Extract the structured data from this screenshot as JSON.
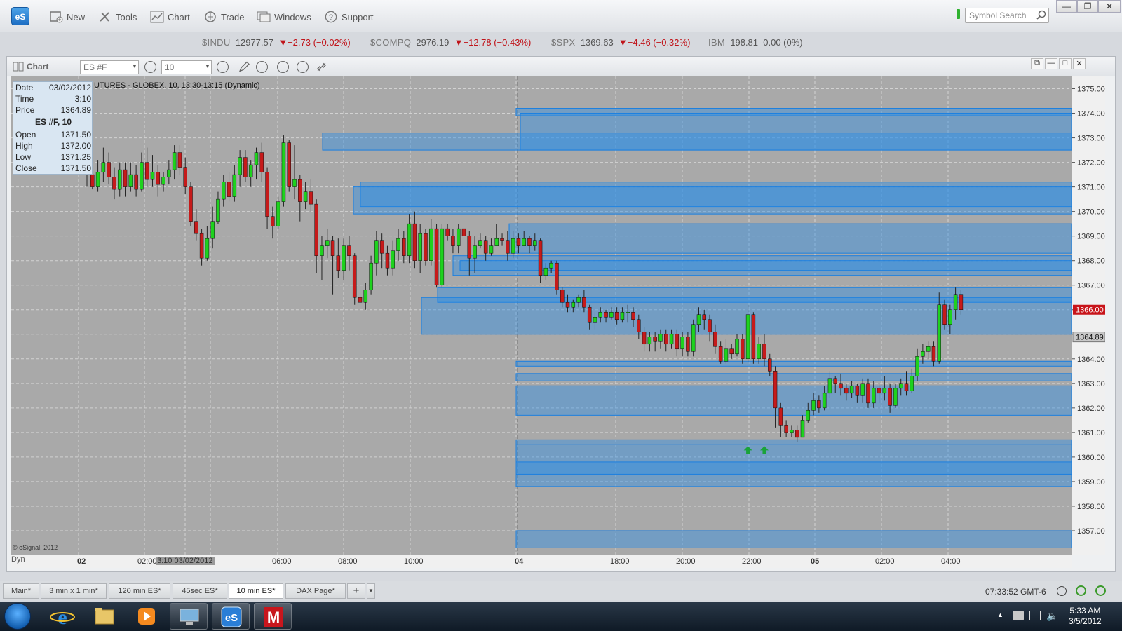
{
  "toolbar": {
    "logo": "eS",
    "items": [
      {
        "label": "New",
        "icon": "new-document-icon"
      },
      {
        "label": "Tools",
        "icon": "tools-icon"
      },
      {
        "label": "Chart",
        "icon": "chart-icon"
      },
      {
        "label": "Trade",
        "icon": "trade-icon"
      },
      {
        "label": "Windows",
        "icon": "windows-icon"
      },
      {
        "label": "Support",
        "icon": "help-icon"
      }
    ],
    "search_placeholder": "Symbol Search"
  },
  "ticker": [
    {
      "symbol": "$INDU",
      "price": "12977.57",
      "change": "▼−2.73 (−0.02%)"
    },
    {
      "symbol": "$COMPQ",
      "price": "2976.19",
      "change": "▼−12.78 (−0.43%)"
    },
    {
      "symbol": "$SPX",
      "price": "1369.63",
      "change": "▼−4.46 (−0.32%)"
    },
    {
      "symbol": "IBM",
      "price": "198.81",
      "change": "0.00 (0%)"
    }
  ],
  "chart_window": {
    "label": "Chart",
    "symbol_field": "ES #F",
    "interval_field": "10",
    "title": "UTURES - GLOBEX, 10, 13:30-13:15 (Dynamic)",
    "copyright": "© eSignal, 2012",
    "dyn": "Dyn"
  },
  "info_panel": {
    "rows_top": [
      {
        "k": "Date",
        "v": "03/02/2012"
      },
      {
        "k": "Time",
        "v": "3:10"
      },
      {
        "k": "Price",
        "v": "1364.89"
      }
    ],
    "header": "ES #F, 10",
    "rows_bottom": [
      {
        "k": "Open",
        "v": "1371.50"
      },
      {
        "k": "High",
        "v": "1372.00"
      },
      {
        "k": "Low",
        "v": "1371.25"
      },
      {
        "k": "Close",
        "v": "1371.50"
      }
    ]
  },
  "chart_data": {
    "type": "candlestick",
    "y_axis": {
      "min": 1356.0,
      "max": 1375.5,
      "ticks": [
        "1375.00",
        "1374.00",
        "1373.00",
        "1372.00",
        "1371.00",
        "1370.00",
        "1369.00",
        "1368.00",
        "1367.00",
        "1366.00",
        "1365.00",
        "1364.00",
        "1363.00",
        "1362.00",
        "1361.00",
        "1360.00",
        "1359.00",
        "1358.00",
        "1357.00"
      ]
    },
    "x_labels": [
      "02",
      "02:00",
      "3:10 03/02/2012",
      "06:00",
      "08:00",
      "10:00",
      "04",
      "18:00",
      "20:00",
      "22:00",
      "05",
      "02:00",
      "04:00"
    ],
    "last_price": "1366.00",
    "cursor_price": "1364.89",
    "zones": [
      {
        "from": 1374.2,
        "to": 1373.9
      },
      {
        "from": 1374.0,
        "to": 1372.5
      },
      {
        "from": 1373.2,
        "to": 1372.5
      },
      {
        "from": 1371.2,
        "to": 1370.2
      },
      {
        "from": 1371.0,
        "to": 1369.9
      },
      {
        "from": 1369.5,
        "to": 1368.3
      },
      {
        "from": 1368.2,
        "to": 1367.4
      },
      {
        "from": 1368.0,
        "to": 1367.6
      },
      {
        "from": 1366.9,
        "to": 1366.3
      },
      {
        "from": 1366.5,
        "to": 1365.0
      },
      {
        "from": 1363.9,
        "to": 1363.7
      },
      {
        "from": 1363.4,
        "to": 1363.1
      },
      {
        "from": 1362.9,
        "to": 1361.7
      },
      {
        "from": 1360.7,
        "to": 1360.5
      },
      {
        "from": 1360.5,
        "to": 1358.8
      },
      {
        "from": 1359.8,
        "to": 1359.3
      },
      {
        "from": 1357.0,
        "to": 1356.3
      }
    ],
    "candles": [
      [
        1371.9,
        1371.5,
        1372.8,
        1371.0
      ],
      [
        1371.5,
        1371.0,
        1372.2,
        1370.9
      ],
      [
        1371.0,
        1371.6,
        1372.1,
        1370.8
      ],
      [
        1371.6,
        1372.0,
        1372.6,
        1371.2
      ],
      [
        1372.0,
        1371.4,
        1372.4,
        1371.1
      ],
      [
        1371.4,
        1370.9,
        1371.8,
        1370.5
      ],
      [
        1370.9,
        1371.7,
        1372.0,
        1370.6
      ],
      [
        1371.7,
        1371.0,
        1372.0,
        1370.6
      ],
      [
        1371.0,
        1371.5,
        1372.0,
        1370.8
      ],
      [
        1371.5,
        1370.9,
        1371.9,
        1370.6
      ],
      [
        1370.9,
        1372.0,
        1372.4,
        1370.8
      ],
      [
        1372.0,
        1371.3,
        1372.6,
        1371.0
      ],
      [
        1371.3,
        1371.6,
        1372.3,
        1371.0
      ],
      [
        1371.6,
        1371.1,
        1371.9,
        1370.6
      ],
      [
        1371.1,
        1371.4,
        1371.6,
        1370.8
      ],
      [
        1371.4,
        1371.7,
        1372.1,
        1371.1
      ],
      [
        1371.7,
        1372.4,
        1372.7,
        1371.3
      ],
      [
        1372.4,
        1371.8,
        1372.7,
        1371.5
      ],
      [
        1371.8,
        1371.0,
        1372.2,
        1370.7
      ],
      [
        1371.0,
        1369.6,
        1371.2,
        1369.4
      ],
      [
        1369.6,
        1369.1,
        1370.1,
        1368.8
      ],
      [
        1369.1,
        1368.1,
        1369.3,
        1367.8
      ],
      [
        1368.1,
        1368.9,
        1369.4,
        1368.0
      ],
      [
        1368.9,
        1369.6,
        1370.2,
        1368.5
      ],
      [
        1369.6,
        1370.5,
        1370.8,
        1369.5
      ],
      [
        1370.5,
        1371.2,
        1371.5,
        1370.2
      ],
      [
        1371.2,
        1370.6,
        1371.6,
        1370.4
      ],
      [
        1370.6,
        1371.5,
        1371.9,
        1370.4
      ],
      [
        1371.5,
        1372.2,
        1372.5,
        1371.0
      ],
      [
        1372.2,
        1371.4,
        1372.5,
        1371.2
      ],
      [
        1371.4,
        1371.9,
        1372.1,
        1371.0
      ],
      [
        1371.9,
        1372.4,
        1372.6,
        1371.3
      ],
      [
        1372.4,
        1371.6,
        1372.8,
        1371.2
      ],
      [
        1371.6,
        1369.8,
        1371.8,
        1369.3
      ],
      [
        1369.8,
        1369.4,
        1370.2,
        1368.9
      ],
      [
        1369.4,
        1370.4,
        1370.6,
        1369.3
      ],
      [
        1370.4,
        1372.8,
        1373.1,
        1370.2
      ],
      [
        1372.8,
        1371.0,
        1372.9,
        1370.8
      ],
      [
        1371.0,
        1371.3,
        1372.7,
        1370.5
      ],
      [
        1371.3,
        1370.4,
        1371.5,
        1369.6
      ],
      [
        1370.4,
        1370.8,
        1371.2,
        1370.1
      ],
      [
        1370.8,
        1370.3,
        1371.3,
        1370.0
      ],
      [
        1370.3,
        1368.2,
        1370.5,
        1367.5
      ],
      [
        1368.2,
        1368.6,
        1369.0,
        1367.2
      ],
      [
        1368.6,
        1368.8,
        1369.3,
        1368.1
      ],
      [
        1368.8,
        1368.2,
        1369.0,
        1366.6
      ],
      [
        1368.2,
        1367.6,
        1368.9,
        1367.3
      ],
      [
        1367.6,
        1368.6,
        1368.9,
        1367.2
      ],
      [
        1368.6,
        1368.2,
        1369.0,
        1367.6
      ],
      [
        1368.2,
        1366.5,
        1368.3,
        1366.2
      ],
      [
        1366.5,
        1366.3,
        1366.9,
        1365.8
      ],
      [
        1366.3,
        1366.8,
        1367.1,
        1366.0
      ],
      [
        1366.8,
        1367.9,
        1368.2,
        1366.6
      ],
      [
        1367.9,
        1368.8,
        1369.2,
        1367.4
      ],
      [
        1368.8,
        1368.3,
        1369.1,
        1367.7
      ],
      [
        1368.3,
        1367.7,
        1368.6,
        1367.4
      ],
      [
        1367.7,
        1368.4,
        1368.8,
        1367.4
      ],
      [
        1368.4,
        1368.9,
        1369.3,
        1368.0
      ],
      [
        1368.9,
        1368.2,
        1369.2,
        1367.9
      ],
      [
        1368.2,
        1369.5,
        1369.9,
        1367.9
      ],
      [
        1369.5,
        1368.0,
        1370.0,
        1367.7
      ],
      [
        1368.0,
        1369.1,
        1369.5,
        1367.5
      ],
      [
        1369.1,
        1368.0,
        1369.3,
        1367.8
      ],
      [
        1368.0,
        1369.3,
        1369.7,
        1367.8
      ],
      [
        1369.3,
        1367.0,
        1369.5,
        1366.9
      ],
      [
        1367.0,
        1369.3,
        1369.5,
        1366.9
      ],
      [
        1369.3,
        1369.0,
        1369.5,
        1368.8
      ],
      [
        1369.0,
        1368.6,
        1369.3,
        1368.3
      ],
      [
        1368.6,
        1369.3,
        1369.5,
        1368.3
      ],
      [
        1369.3,
        1369.0,
        1369.5,
        1368.7
      ],
      [
        1369.0,
        1368.1,
        1369.2,
        1367.4
      ],
      [
        1368.1,
        1368.6,
        1369.0,
        1367.5
      ],
      [
        1368.6,
        1368.8,
        1369.1,
        1368.5
      ],
      [
        1368.8,
        1368.3,
        1369.0,
        1368.0
      ],
      [
        1368.3,
        1368.6,
        1368.9,
        1368.2
      ],
      [
        1368.6,
        1368.9,
        1369.5,
        1368.6
      ],
      [
        1368.9,
        1368.8,
        1369.1,
        1368.6
      ],
      [
        1368.8,
        1368.3,
        1369.2,
        1368.0
      ],
      [
        1368.3,
        1368.9,
        1369.2,
        1368.1
      ],
      [
        1368.9,
        1368.6,
        1369.1,
        1368.3
      ],
      [
        1368.6,
        1368.9,
        1369.2,
        1368.6
      ],
      [
        1368.9,
        1368.6,
        1369.0,
        1368.3
      ],
      [
        1368.6,
        1368.8,
        1369.1,
        1368.4
      ],
      [
        1368.8,
        1367.4,
        1368.9,
        1367.1
      ],
      [
        1367.4,
        1367.7,
        1367.9,
        1367.2
      ],
      [
        1367.7,
        1367.9,
        1368.0,
        1367.5
      ],
      [
        1367.9,
        1366.8,
        1368.0,
        1366.6
      ],
      [
        1366.8,
        1366.3,
        1366.9,
        1366.1
      ],
      [
        1366.3,
        1366.1,
        1366.6,
        1365.9
      ],
      [
        1366.1,
        1366.3,
        1366.4,
        1365.9
      ],
      [
        1366.3,
        1366.5,
        1366.6,
        1366.1
      ],
      [
        1366.5,
        1366.1,
        1366.8,
        1365.9
      ],
      [
        1366.1,
        1365.5,
        1366.2,
        1365.2
      ],
      [
        1365.5,
        1365.7,
        1365.9,
        1365.2
      ],
      [
        1365.7,
        1365.9,
        1366.1,
        1365.5
      ],
      [
        1365.9,
        1365.7,
        1366.0,
        1365.5
      ],
      [
        1365.7,
        1365.9,
        1366.1,
        1365.6
      ],
      [
        1365.9,
        1365.6,
        1366.1,
        1365.4
      ],
      [
        1365.6,
        1365.9,
        1366.1,
        1365.5
      ],
      [
        1365.9,
        1365.9,
        1366.2,
        1365.5
      ],
      [
        1365.9,
        1365.6,
        1366.1,
        1365.3
      ],
      [
        1365.6,
        1365.1,
        1365.8,
        1364.8
      ],
      [
        1365.1,
        1364.6,
        1365.3,
        1364.3
      ],
      [
        1364.6,
        1364.9,
        1365.1,
        1364.3
      ],
      [
        1364.9,
        1364.7,
        1365.1,
        1364.3
      ],
      [
        1364.7,
        1365.0,
        1365.2,
        1364.4
      ],
      [
        1365.0,
        1364.6,
        1365.2,
        1364.3
      ],
      [
        1364.6,
        1365.0,
        1365.2,
        1364.4
      ],
      [
        1365.0,
        1364.4,
        1365.2,
        1364.1
      ],
      [
        1364.4,
        1364.9,
        1365.1,
        1364.1
      ],
      [
        1364.9,
        1364.3,
        1365.1,
        1364.1
      ],
      [
        1364.3,
        1365.4,
        1365.6,
        1364.1
      ],
      [
        1365.4,
        1365.8,
        1366.1,
        1365.1
      ],
      [
        1365.8,
        1365.6,
        1366.0,
        1365.2
      ],
      [
        1365.6,
        1365.1,
        1365.8,
        1364.7
      ],
      [
        1365.1,
        1364.5,
        1365.4,
        1364.2
      ],
      [
        1364.5,
        1363.9,
        1364.7,
        1363.8
      ],
      [
        1363.9,
        1364.4,
        1364.8,
        1363.8
      ],
      [
        1364.4,
        1364.2,
        1364.6,
        1364.0
      ],
      [
        1364.2,
        1364.8,
        1365.0,
        1364.1
      ],
      [
        1364.8,
        1364.0,
        1365.0,
        1363.8
      ],
      [
        1364.0,
        1365.8,
        1366.2,
        1363.8
      ],
      [
        1365.8,
        1364.0,
        1365.9,
        1363.8
      ],
      [
        1364.0,
        1364.6,
        1364.9,
        1363.8
      ],
      [
        1364.6,
        1364.0,
        1365.0,
        1363.7
      ],
      [
        1364.0,
        1363.5,
        1364.2,
        1363.3
      ],
      [
        1363.5,
        1362.0,
        1363.7,
        1361.2
      ],
      [
        1362.0,
        1361.3,
        1362.2,
        1360.8
      ],
      [
        1361.3,
        1361.0,
        1361.5,
        1360.8
      ],
      [
        1361.0,
        1361.1,
        1361.3,
        1360.8
      ],
      [
        1361.1,
        1360.8,
        1361.3,
        1360.6
      ],
      [
        1360.8,
        1361.5,
        1361.7,
        1360.8
      ],
      [
        1361.5,
        1361.9,
        1362.2,
        1361.4
      ],
      [
        1361.9,
        1362.3,
        1362.6,
        1361.7
      ],
      [
        1362.3,
        1362.0,
        1362.5,
        1361.8
      ],
      [
        1362.0,
        1362.6,
        1362.9,
        1361.9
      ],
      [
        1362.6,
        1363.2,
        1363.5,
        1362.4
      ],
      [
        1363.2,
        1363.0,
        1363.3,
        1362.6
      ],
      [
        1363.0,
        1362.8,
        1363.4,
        1362.5
      ],
      [
        1362.8,
        1362.6,
        1363.0,
        1362.3
      ],
      [
        1362.6,
        1362.9,
        1363.1,
        1362.4
      ],
      [
        1362.9,
        1362.5,
        1363.0,
        1362.2
      ],
      [
        1362.5,
        1363.0,
        1363.2,
        1362.2
      ],
      [
        1363.0,
        1362.2,
        1363.2,
        1362.0
      ],
      [
        1362.2,
        1362.8,
        1363.1,
        1362.0
      ],
      [
        1362.8,
        1362.6,
        1363.0,
        1362.2
      ],
      [
        1362.6,
        1362.8,
        1363.3,
        1362.3
      ],
      [
        1362.8,
        1362.1,
        1363.0,
        1361.8
      ],
      [
        1362.1,
        1362.8,
        1363.0,
        1362.0
      ],
      [
        1362.8,
        1363.0,
        1363.2,
        1362.5
      ],
      [
        1363.0,
        1362.7,
        1363.5,
        1362.5
      ],
      [
        1362.7,
        1363.3,
        1363.6,
        1362.6
      ],
      [
        1363.3,
        1364.1,
        1364.4,
        1363.1
      ],
      [
        1364.1,
        1364.3,
        1364.6,
        1363.8
      ],
      [
        1364.3,
        1364.5,
        1364.7,
        1364.0
      ],
      [
        1364.5,
        1363.9,
        1364.7,
        1363.7
      ],
      [
        1363.9,
        1366.2,
        1366.7,
        1363.8
      ],
      [
        1366.2,
        1365.4,
        1366.4,
        1365.2
      ],
      [
        1365.4,
        1366.0,
        1366.2,
        1365.0
      ],
      [
        1366.0,
        1366.6,
        1366.9,
        1365.6
      ],
      [
        1366.6,
        1366.0,
        1366.8,
        1365.8
      ]
    ],
    "buy_signals_at_candle": [
      121,
      124
    ]
  },
  "tabs": [
    "Main*",
    "3 min x 1 min*",
    "120 min ES*",
    "45sec ES*",
    "10 min ES*",
    "DAX Page*"
  ],
  "active_tab": "10 min ES*",
  "status_clock": "07:33:52 GMT-6",
  "taskbar": {
    "time": "5:33 AM",
    "date": "3/5/2012"
  }
}
